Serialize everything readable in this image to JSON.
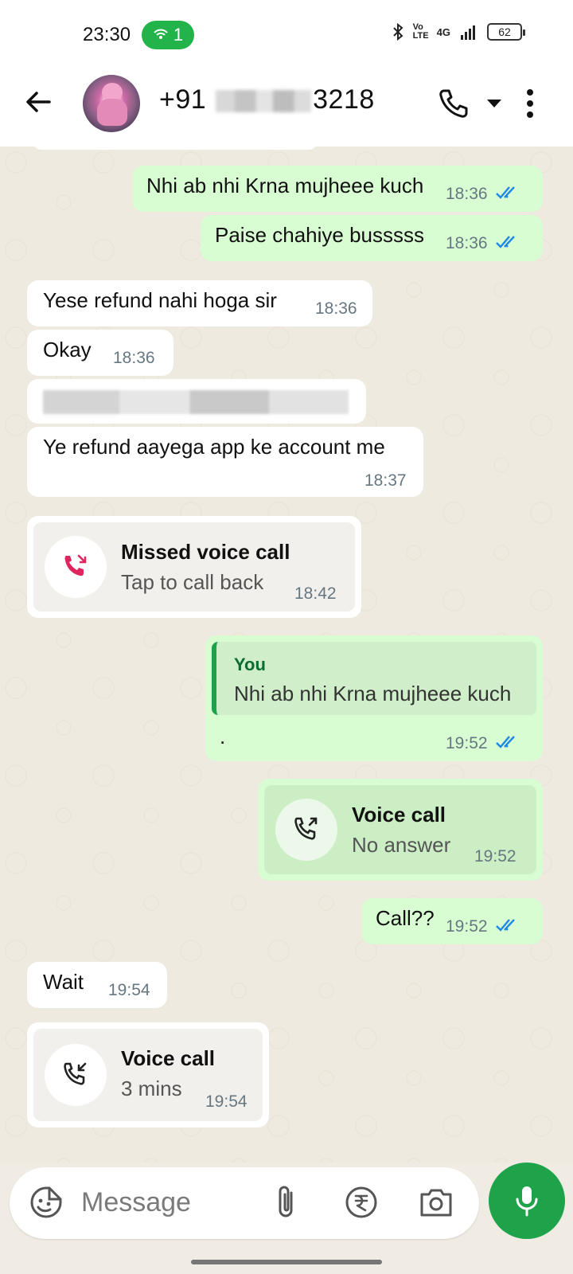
{
  "status_bar": {
    "time": "23:30",
    "hotspot_count": "1",
    "network_label": "4G",
    "volte_label": "Vo LTE",
    "battery": "62"
  },
  "header": {
    "contact_prefix": "+91",
    "contact_suffix": "3218"
  },
  "messages": [
    {
      "direction": "out",
      "text": "Nhi ab nhi Krna mujheee kuch",
      "time": "18:36",
      "status": "read"
    },
    {
      "direction": "out",
      "text": "Paise chahiye busssss",
      "time": "18:36",
      "status": "read"
    },
    {
      "direction": "in",
      "text": "Yese refund nahi hoga sir",
      "time": "18:36"
    },
    {
      "direction": "in",
      "text": "Okay",
      "time": "18:36"
    },
    {
      "direction": "in",
      "text": "",
      "redacted": true
    },
    {
      "direction": "in",
      "text": "Ye refund aayega app ke account me",
      "time": "18:37"
    }
  ],
  "calls": {
    "missed": {
      "title": "Missed voice call",
      "subtitle": "Tap to call back",
      "time": "18:42"
    },
    "outgoing": {
      "title": "Voice call",
      "subtitle": "No answer",
      "time": "19:52"
    },
    "incoming": {
      "title": "Voice call",
      "subtitle": "3 mins",
      "time": "19:54"
    }
  },
  "reply": {
    "author": "You",
    "quoted_text": "Nhi ab nhi Krna mujheee kuch",
    "text": ".",
    "time": "19:52",
    "status": "read"
  },
  "later_messages": [
    {
      "direction": "out",
      "text": "Call??",
      "time": "19:52",
      "status": "read"
    },
    {
      "direction": "in",
      "text": "Wait",
      "time": "19:54"
    }
  ],
  "input": {
    "placeholder": "Message"
  },
  "colors": {
    "accent_green": "#1ea34a",
    "outgoing_bubble": "#d9fdd3",
    "incoming_bubble": "#ffffff",
    "read_tick": "#1e88e5",
    "missed_call_red": "#e0245e"
  }
}
